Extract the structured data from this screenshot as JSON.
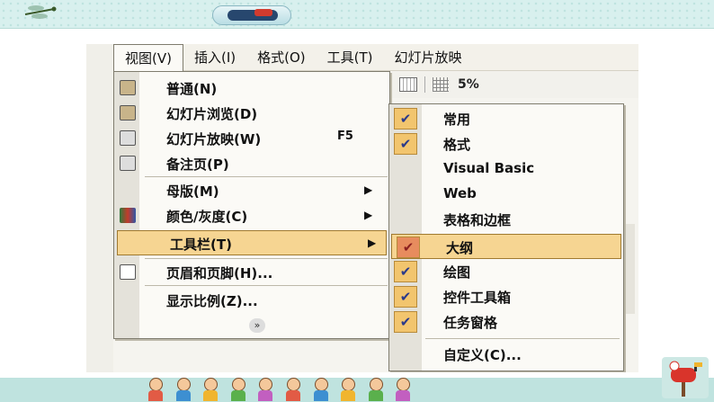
{
  "menubar": {
    "items": [
      {
        "label": "视图(V)"
      },
      {
        "label": "插入(I)"
      },
      {
        "label": "格式(O)"
      },
      {
        "label": "工具(T)"
      },
      {
        "label": "幻灯片放映"
      }
    ]
  },
  "toolbar": {
    "zoom": "5%"
  },
  "view_menu": {
    "items": [
      {
        "label": "普通(N)",
        "icon": "normal-view-icon"
      },
      {
        "label": "幻灯片浏览(D)",
        "icon": "slide-sorter-icon"
      },
      {
        "label": "幻灯片放映(W)",
        "shortcut": "F5",
        "icon": "slideshow-icon"
      },
      {
        "label": "备注页(P)",
        "icon": "notes-page-icon"
      },
      {
        "label": "母版(M)",
        "submenu": true
      },
      {
        "label": "颜色/灰度(C)",
        "submenu": true,
        "icon": "color-grayscale-icon"
      },
      {
        "label": "工具栏(T)",
        "submenu": true,
        "highlighted": true
      },
      {
        "label": "页眉和页脚(H)...",
        "icon": "header-footer-icon"
      },
      {
        "label": "显示比例(Z)..."
      }
    ],
    "expand_glyph": "»"
  },
  "toolbars_submenu": {
    "items": [
      {
        "label": "常用",
        "checked": true
      },
      {
        "label": "格式",
        "checked": true
      },
      {
        "label": "Visual Basic",
        "checked": false
      },
      {
        "label": "Web",
        "checked": false
      },
      {
        "label": "表格和边框",
        "checked": false
      },
      {
        "label": "大纲",
        "checked": true,
        "highlighted": true
      },
      {
        "label": "绘图",
        "checked": true
      },
      {
        "label": "控件工具箱",
        "checked": true
      },
      {
        "label": "任务窗格",
        "checked": true
      },
      {
        "label": "自定义(C)...",
        "checked": false
      }
    ],
    "check_glyph": "✔"
  },
  "colors": {
    "highlight": "#f6d592",
    "check_bg": "#f2c56e",
    "check_active_bg": "#e78c5e",
    "band": "#d8f0ee"
  }
}
